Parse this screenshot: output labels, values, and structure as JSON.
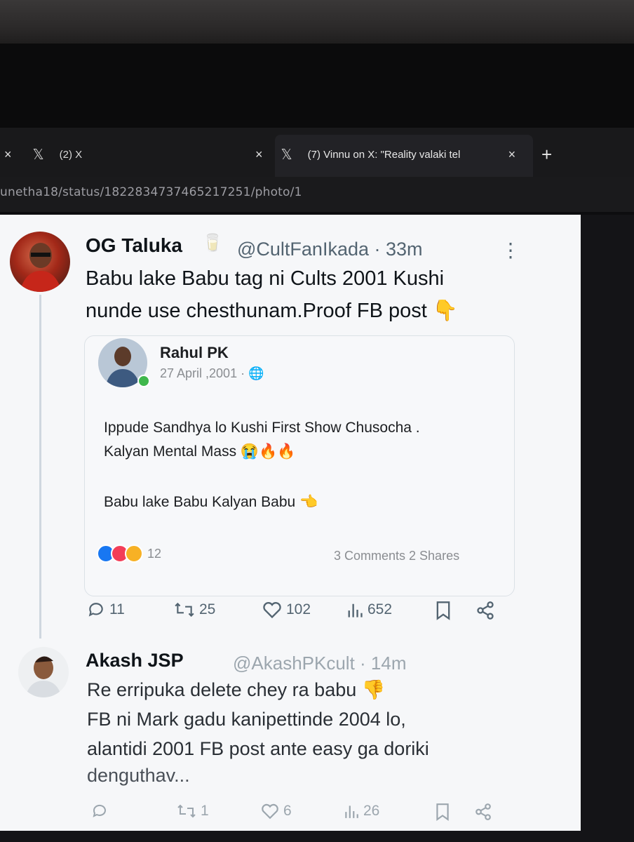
{
  "tabs": [
    {
      "close": "×",
      "icon": "x-logo-icon",
      "title": "(2) X"
    },
    {
      "close": "×",
      "icon": "x-logo-icon",
      "title": "(7) Vinnu on X: \"Reality valaki tel"
    }
  ],
  "tab_close_active": "×",
  "new_tab": "+",
  "address": "unetha18/status/1822834737465217251/photo/1",
  "tweet": {
    "name": "OG Taluka",
    "emoji": "🥛",
    "handle": "@CultFanIkada · 33m",
    "more": "⋮",
    "text_line1": "Babu lake Babu tag ni Cults 2001 Kushi",
    "text_line2": "nunde use chesthunam.Proof FB post 👇",
    "quote": {
      "name": "Rahul PK",
      "date": "27 April ,2001 · 🌐",
      "line1": "Ippude Sandhya lo Kushi First Show Chusocha .",
      "line2": "Kalyan Mental Mass 😭🔥🔥",
      "line3": "Babu lake Babu Kalyan Babu 👈",
      "reactions_count": "12",
      "comments_shares": "3 Comments 2 Shares"
    },
    "replies": "11",
    "reposts": "25",
    "likes": "102",
    "views": "652"
  },
  "reply": {
    "name": "Akash JSP",
    "handle": "@AkashPKcult · 14m",
    "line1": "Re erripuka delete chey ra babu 👎",
    "line2": "FB ni Mark gadu kanipettinde 2004 lo,",
    "line3": "alantidi 2001 FB post ante easy ga doriki",
    "line4": "denguthav...",
    "replies": "",
    "reposts": "1",
    "likes": "6",
    "views": "26"
  }
}
